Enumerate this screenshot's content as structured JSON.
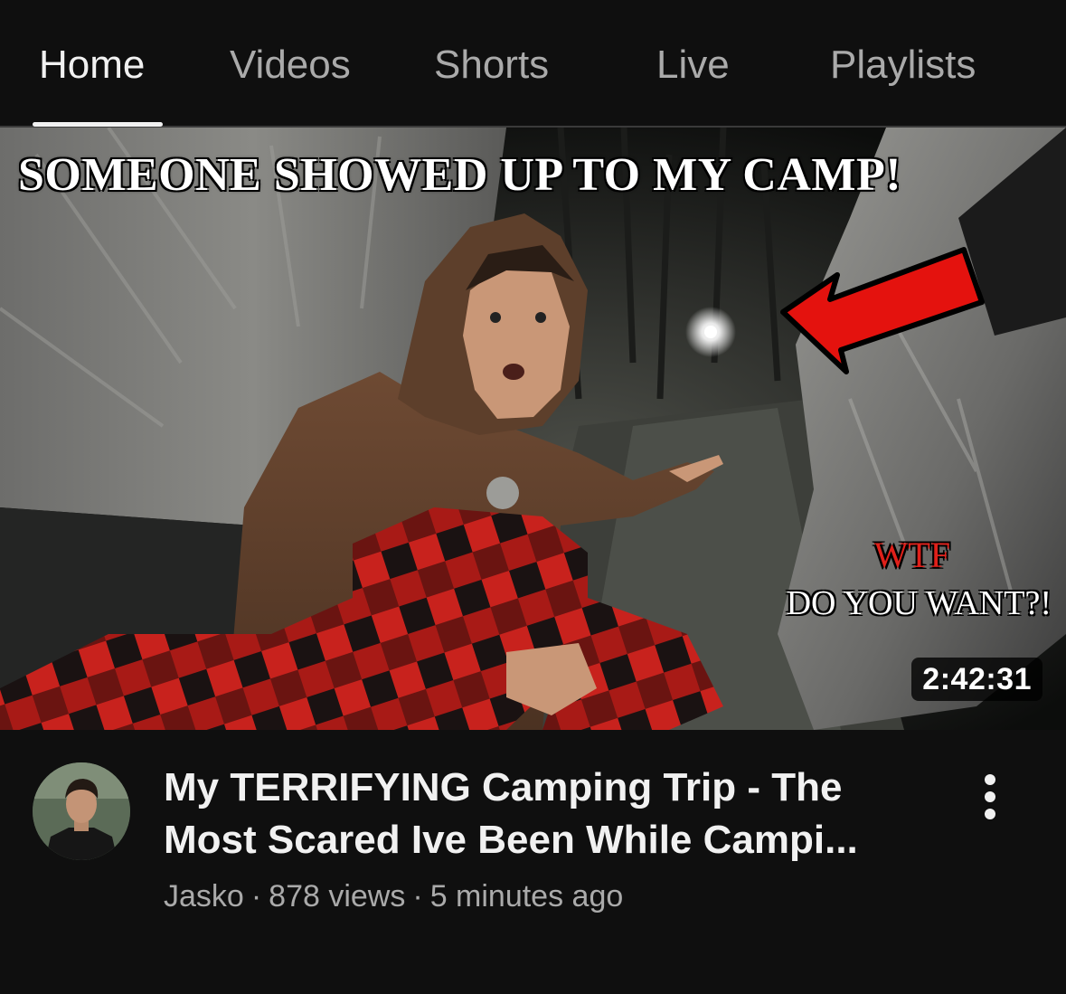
{
  "tabs": [
    {
      "label": "Home",
      "active": true
    },
    {
      "label": "Videos",
      "active": false
    },
    {
      "label": "Shorts",
      "active": false
    },
    {
      "label": "Live",
      "active": false
    },
    {
      "label": "Playlists",
      "active": false
    }
  ],
  "thumbnail": {
    "headline": "SOMEONE SHOWED UP TO MY CAMP!",
    "caption_red": "WTF",
    "caption_white": "DO YOU WANT?!",
    "duration": "2:42:31",
    "arrow_color": "#e4120e"
  },
  "video": {
    "title_line1": "My TERRIFYING Camping Trip - The",
    "title_line2": "Most Scared Ive Been While Campi...",
    "channel": "Jasko",
    "views": "878 views",
    "age": "5 minutes ago",
    "separator": "·"
  },
  "icons": {
    "more": "more-vert-icon",
    "avatar": "channel-avatar"
  },
  "colors": {
    "background": "#0f0f0f",
    "text_primary": "#f1f1f1",
    "text_secondary": "#aaaaaa"
  }
}
